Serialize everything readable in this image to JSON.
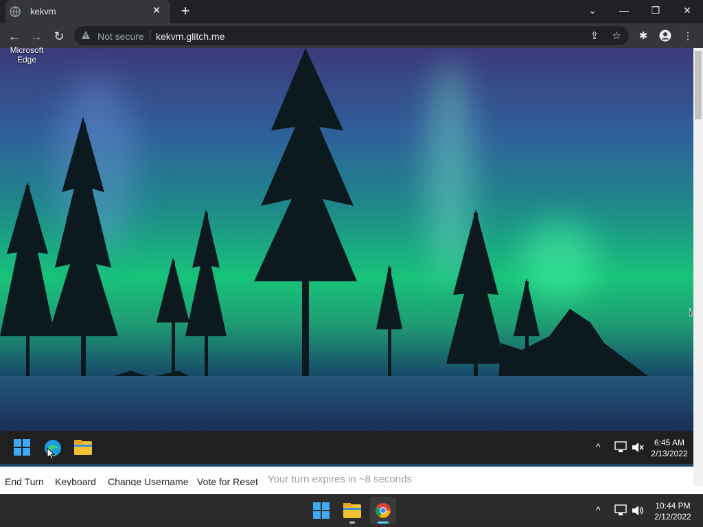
{
  "browser": {
    "tab": {
      "title": "kekvm",
      "close": "✕"
    },
    "new_tab": "+",
    "window_controls": {
      "dropdown": "⌄",
      "minimize": "—",
      "restore": "❐",
      "close": "✕"
    },
    "nav": {
      "back": "←",
      "forward": "→",
      "reload": "↻"
    },
    "omnibox": {
      "security_label": "Not secure",
      "url": "kekvm.glitch.me"
    },
    "omnibox_icons": {
      "share": "⇪",
      "bookmark": "☆"
    },
    "toolbar_icons": {
      "extensions": "✱",
      "profile": "●",
      "menu": "⋮"
    }
  },
  "remote": {
    "desktop_icon_label": "Microsoft\nEdge",
    "taskbar": {
      "tray_chevron": "^",
      "time": "6:45 AM",
      "date": "2/13/2022"
    }
  },
  "controls": {
    "end_turn": "End Turn",
    "keyboard": "Keyboard",
    "change_username": "Change Username",
    "vote_reset": "Vote for Reset",
    "turn_status": "Your turn expires in ~8 seconds"
  },
  "host": {
    "taskbar": {
      "tray_chevron": "^",
      "time": "10:44 PM",
      "date": "2/12/2022"
    }
  },
  "colors": {
    "chrome_dark": "#202124",
    "chrome_toolbar": "#35363a",
    "aurora_green": "#18c37a",
    "taskbar": "#202020"
  }
}
